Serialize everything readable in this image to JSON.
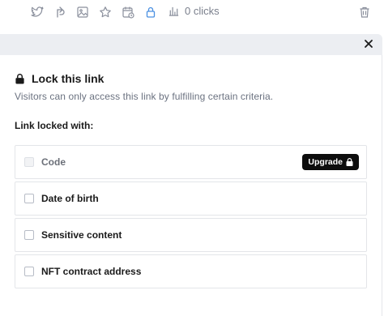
{
  "toolbar": {
    "icons": [
      "twitter-icon",
      "share-icon",
      "image-icon",
      "star-icon",
      "schedule-icon",
      "lock-icon",
      "bar-chart-icon",
      "trash-icon"
    ],
    "clicks_label": "0 clicks",
    "accent_color": "#4a90e2",
    "icon_color": "#8a8f9c"
  },
  "lock_panel": {
    "title": "Lock this link",
    "description": "Visitors can only access this link by fulfilling certain criteria.",
    "locked_with_label": "Link locked with:",
    "options": [
      {
        "label": "Code",
        "disabled": true,
        "badge": "Upgrade"
      },
      {
        "label": "Date of birth",
        "disabled": false
      },
      {
        "label": "Sensitive content",
        "disabled": false
      },
      {
        "label": "NFT contract address",
        "disabled": false
      }
    ]
  }
}
